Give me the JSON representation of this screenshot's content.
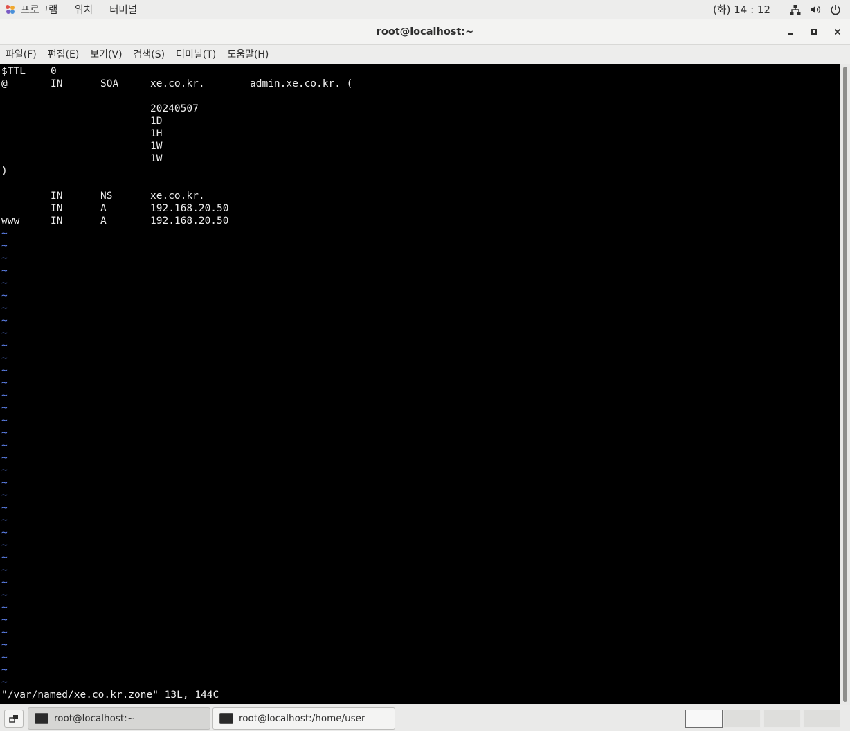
{
  "top_panel": {
    "menus": [
      "프로그램",
      "위치",
      "터미널"
    ],
    "clock": "(화) 14 : 12",
    "tray_icons": [
      "network-icon",
      "volume-icon",
      "power-icon"
    ]
  },
  "window": {
    "title": "root@localhost:~",
    "controls": [
      "minimize-icon",
      "maximize-icon",
      "close-icon"
    ]
  },
  "menubar": [
    "파일(F)",
    "편집(E)",
    "보기(V)",
    "검색(S)",
    "터미널(T)",
    "도움말(H)"
  ],
  "terminal": {
    "lines": [
      [
        "$TTL",
        "0",
        "",
        "",
        ""
      ],
      [
        "@",
        "IN",
        "SOA",
        "xe.co.kr.",
        "admin.xe.co.kr. ("
      ],
      [
        "",
        "",
        "",
        "",
        ""
      ],
      [
        "",
        "",
        "",
        "20240507",
        ""
      ],
      [
        "",
        "",
        "",
        "1D",
        ""
      ],
      [
        "",
        "",
        "",
        "1H",
        ""
      ],
      [
        "",
        "",
        "",
        "1W",
        ""
      ],
      [
        "",
        "",
        "",
        "1W",
        ""
      ],
      [
        ")",
        "",
        "",
        "",
        ""
      ],
      [
        "",
        "",
        "",
        "",
        ""
      ],
      [
        "",
        "IN",
        "NS",
        "xe.co.kr.",
        ""
      ],
      [
        "",
        "IN",
        "A",
        "192.168.20.50",
        ""
      ],
      [
        "www",
        "IN",
        "A",
        "192.168.20.50",
        ""
      ]
    ],
    "empty_line_marker": "~",
    "status_line": "\"/var/named/xe.co.kr.zone\" 13L, 144C"
  },
  "taskbar": {
    "tasks": [
      {
        "label": "root@localhost:~",
        "active": true
      },
      {
        "label": "root@localhost:/home/user",
        "active": false
      }
    ]
  },
  "colors": {
    "terminal_bg": "#000000",
    "terminal_fg": "#ededed",
    "tilde": "#5c7fe8",
    "panel_bg": "#ededec"
  }
}
